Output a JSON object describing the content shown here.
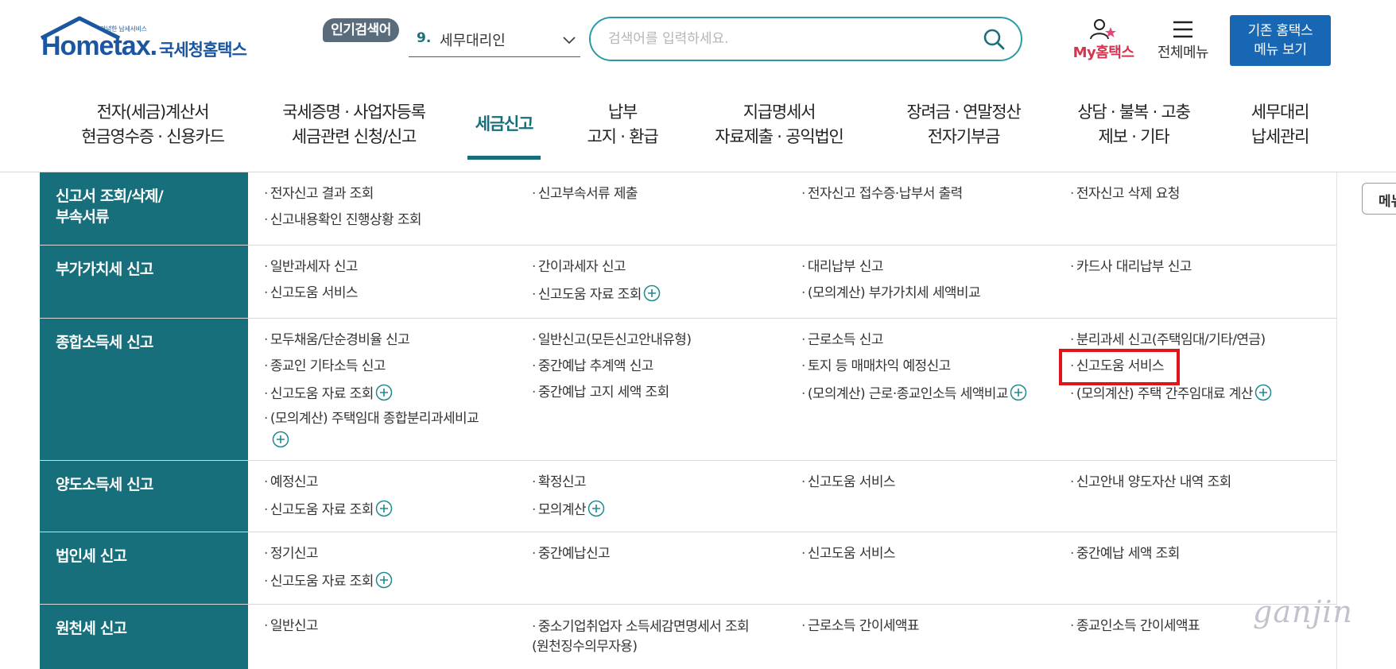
{
  "header": {
    "logo_small": "안녕한 납세서비스",
    "logo_main": "Hometax.",
    "logo_kr": "국세청홈택스",
    "popular_badge": "인기검색어",
    "popular_keyword": {
      "rank": "9.",
      "text": "세무대리인"
    },
    "search": {
      "placeholder": "검색어를 입력하세요.",
      "value": ""
    },
    "mytax_label": "My홈택스",
    "allmenu_label": "전체메뉴",
    "legacy_button": [
      "기존 홈택스",
      "메뉴 보기"
    ]
  },
  "gnb": {
    "items": [
      {
        "lines": [
          "전자(세금)계산서",
          "현금영수증 · 신용카드"
        ]
      },
      {
        "lines": [
          "국세증명 · 사업자등록",
          "세금관련 신청/신고"
        ]
      },
      {
        "lines": [
          "세금신고"
        ],
        "active": true
      },
      {
        "lines": [
          "납부",
          "고지 · 환급"
        ]
      },
      {
        "lines": [
          "지급명세서",
          "자료제출 · 공익법인"
        ]
      },
      {
        "lines": [
          "장려금 · 연말정산",
          "전자기부금"
        ]
      },
      {
        "lines": [
          "상담 · 불복 · 고충",
          "제보 · 기타"
        ]
      },
      {
        "lines": [
          "세무대리",
          "납세관리"
        ]
      }
    ]
  },
  "menu_rows": [
    {
      "title": "신고서 조회/삭제/\n부속서류",
      "items": [
        {
          "label": "전자신고 결과 조회"
        },
        {
          "label": "신고부속서류 제출"
        },
        {
          "label": "전자신고 접수증·납부서 출력"
        },
        {
          "label": "전자신고 삭제 요청"
        },
        {
          "label": "신고내용확인 진행상황 조회"
        }
      ]
    },
    {
      "title": "부가가치세 신고",
      "items": [
        {
          "label": "일반과세자 신고"
        },
        {
          "label": "간이과세자 신고"
        },
        {
          "label": "대리납부 신고"
        },
        {
          "label": "카드사 대리납부 신고"
        },
        {
          "label": "신고도움 서비스"
        },
        {
          "label": "신고도움 자료 조회",
          "plus": true
        },
        {
          "label": "(모의계산) 부가가치세 세액비교"
        }
      ]
    },
    {
      "title": "종합소득세 신고",
      "items": [
        {
          "label": "모두채움/단순경비율 신고"
        },
        {
          "label": "일반신고(모든신고안내유형)"
        },
        {
          "label": "근로소득 신고"
        },
        {
          "label": "분리과세 신고(주택임대/기타/연금)"
        },
        {
          "label": "종교인 기타소득 신고"
        },
        {
          "label": "중간예납 추계액 신고"
        },
        {
          "label": "토지 등 매매차익 예정신고"
        },
        {
          "label": "신고도움 서비스",
          "highlighted": true
        },
        {
          "label": "신고도움 자료 조회",
          "plus": true
        },
        {
          "label": "중간예납 고지 세액 조회"
        },
        {
          "label": "(모의계산) 근로·종교인소득 세액비교",
          "plus": true
        },
        {
          "label": "(모의계산) 주택 간주임대료 계산",
          "plus": true
        },
        {
          "label": "(모의계산) 주택임대 종합분리과세비교",
          "plus": true
        }
      ]
    },
    {
      "title": "양도소득세 신고",
      "items": [
        {
          "label": "예정신고"
        },
        {
          "label": "확정신고"
        },
        {
          "label": "신고도움 서비스"
        },
        {
          "label": "신고안내 양도자산 내역 조회"
        },
        {
          "label": "신고도움 자료 조회",
          "plus": true
        },
        {
          "label": "모의계산",
          "plus": true
        }
      ]
    },
    {
      "title": "법인세 신고",
      "items": [
        {
          "label": "정기신고"
        },
        {
          "label": "중간예납신고"
        },
        {
          "label": "신고도움 서비스"
        },
        {
          "label": "중간예납 세액 조회"
        },
        {
          "label": "신고도움 자료 조회",
          "plus": true
        }
      ]
    },
    {
      "title": "원천세 신고",
      "items": [
        {
          "label": "일반신고"
        },
        {
          "label": "중소기업취업자 소득세감면명세서 조회\n(원천징수의무자용)"
        },
        {
          "label": "근로소득 간이세액표"
        },
        {
          "label": "종교인소득 간이세액표"
        }
      ]
    }
  ],
  "side_button_label": "메뉴",
  "watermark": "ganjin",
  "colors": {
    "teal": "#176f7b",
    "brand_blue": "#1767b5",
    "mytax_red": "#d6334f",
    "highlight_red": "#e2141b"
  }
}
